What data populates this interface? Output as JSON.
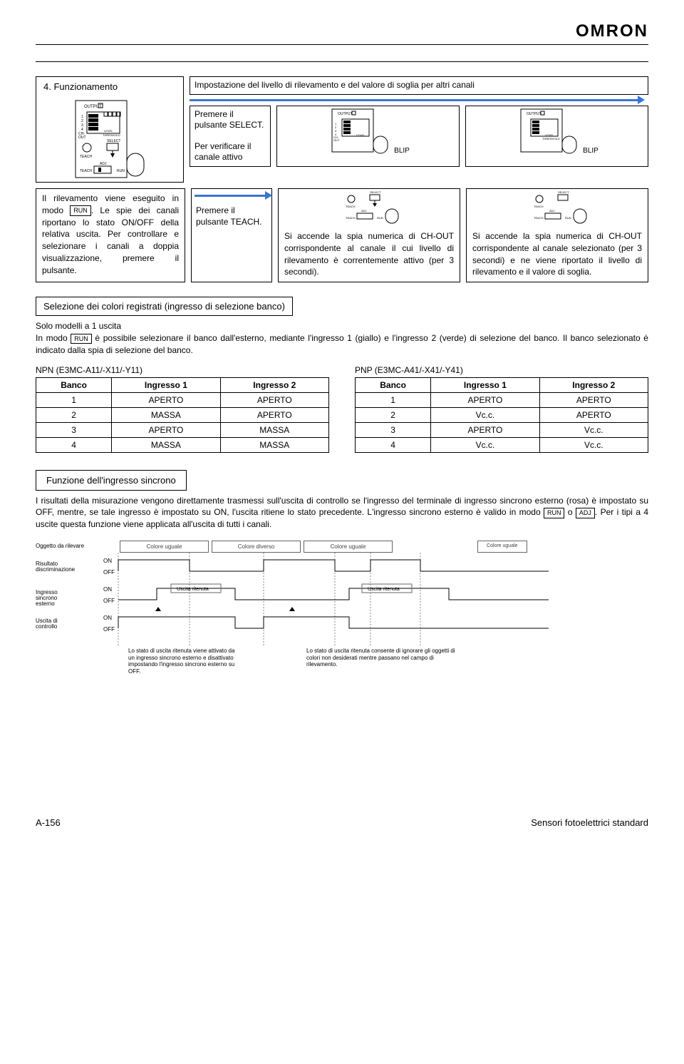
{
  "brand": "OMRON",
  "section4": {
    "title": "4. Funzionamento",
    "impostazione": "Impostazione del livello di rilevamento e del valore di soglia per altri canali",
    "premere_select": "Premere il pulsante SELECT.",
    "verificare": "Per verificare il canale attivo",
    "blip": "BLIP",
    "rilevamento1a": "Il rilevamento viene eseguito in modo ",
    "rilevamento1b": ". Le spie dei canali riportano lo stato ON/OFF della relativa uscita. Per controllare e selezionare i canali a doppia visualizzazione, premere il pulsante.",
    "premere_teach": "Premere il pulsante TEACH.",
    "chout_text": "Si accende la spia numerica di CH-OUT corrispondente al canale il cui livello di rilevamento è correntemente attivo (per 3 secondi).",
    "chout_text2": "Si accende la spia numerica di CH-OUT corrispondente al canale selezionato (per 3 secondi) e ne viene riportato il livello di rilevamento e il valore di soglia.",
    "run": "RUN"
  },
  "selezione": {
    "title": "Selezione dei colori registrati (ingresso di selezione banco)",
    "solo": "Solo modelli a 1 uscita",
    "inmodo_a": "In modo ",
    "inmodo_b": " è possibile selezionare il banco dall'esterno, mediante l'ingresso 1 (giallo) e l'ingresso 2 (verde) di selezione del banco. Il banco selezionato è indicato dalla spia di selezione del banco.",
    "npn_title": "NPN (E3MC-A11/-X11/-Y11)",
    "pnp_title": "PNP (E3MC-A41/-X41/-Y41)",
    "headers": [
      "Banco",
      "Ingresso 1",
      "Ingresso 2"
    ],
    "npn": [
      [
        "1",
        "APERTO",
        "APERTO"
      ],
      [
        "2",
        "MASSA",
        "APERTO"
      ],
      [
        "3",
        "APERTO",
        "MASSA"
      ],
      [
        "4",
        "MASSA",
        "MASSA"
      ]
    ],
    "pnp": [
      [
        "1",
        "APERTO",
        "APERTO"
      ],
      [
        "2",
        "Vc.c.",
        "APERTO"
      ],
      [
        "3",
        "APERTO",
        "Vc.c."
      ],
      [
        "4",
        "Vc.c.",
        "Vc.c."
      ]
    ]
  },
  "sincrono": {
    "title": "Funzione dell'ingresso sincrono",
    "body_a": "I risultati della misurazione vengono direttamente trasmessi sull'uscita di controllo se l'ingresso del terminale di ingresso sincrono esterno (rosa) è impostato su OFF, mentre, se tale ingresso è impostato su ON, l'uscita ritiene lo stato precedente. L'ingresso sincrono esterno è valido in modo ",
    "body_b": " o ",
    "body_c": ". Per i tipi a 4 uscite questa funzione viene applicata all'uscita di tutti i canali.",
    "run": "RUN",
    "adj": "ADJ",
    "oggetto": "Oggetto da rilevare",
    "colore_uguale": "Colore uguale",
    "colore_diverso": "Colore diverso",
    "risultato": "Risultato discriminazione",
    "ingresso": "Ingresso sincrono esterno",
    "uscita": "Uscita di controllo",
    "on": "ON",
    "off": "OFF",
    "ritenuta": "Uscita ritenuta",
    "note1": "Lo stato di uscita ritenuta viene attivato da un ingresso sincrono esterno e disattivato impostando l'ingresso sincrono esterno su OFF.",
    "note2": "Lo stato di uscita ritenuta consente di ignorare gli oggetti di colori non desiderati mentre passano nel campo di rilevamento."
  },
  "footer": {
    "left": "A-156",
    "right": "Sensori fotoelettrici standard"
  }
}
